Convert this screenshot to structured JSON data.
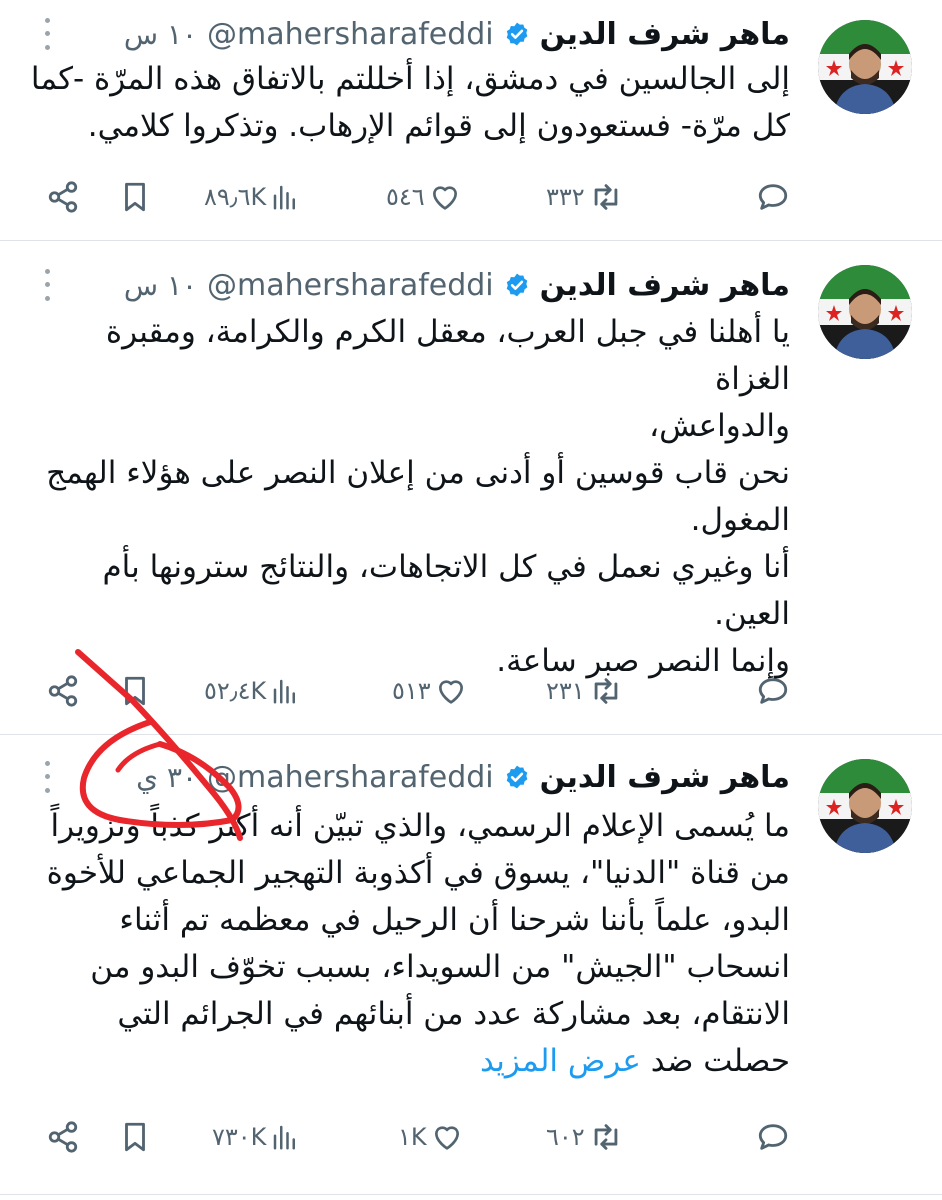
{
  "tweets": [
    {
      "display_name": "ماهر شرف الدين",
      "handle": "@mahersharafeddi",
      "time": "١٠ س",
      "text": "إلى الجالسين في دمشق، إذا أخللتم بالاتفاق هذه المرّة -كما\nكل مرّة- فستعودون إلى قوائم الإرهاب. وتذكروا كلامي.",
      "show_more": "",
      "replies": "",
      "retweets": "٣٣٢",
      "likes": "٥٤٦",
      "views": "٨٩٫٦K"
    },
    {
      "display_name": "ماهر شرف الدين",
      "handle": "@mahersharafeddi",
      "time": "١٠ س",
      "text": "يا أهلنا في جبل العرب، معقل الكرم والكرامة، ومقبرة الغزاة\nوالدواعش،\nنحن قاب قوسين أو أدنى من إعلان النصر على هؤلاء الهمج\nالمغول.\nأنا وغيري نعمل في كل الاتجاهات، والنتائج سترونها بأم\nالعين.\nوإنما النصر صبر ساعة.",
      "show_more": "",
      "replies": "",
      "retweets": "٢٣١",
      "likes": "٥١٣",
      "views": "٥٢٫٤K"
    },
    {
      "display_name": "ماهر شرف الدين",
      "handle": "@mahersharafeddi",
      "time": "٣٠ ي",
      "text": "ما يُسمى الإعلام الرسمي، والذي تبيّن أنه أكثر كذباً وتزويراً\nمن قناة \"الدنيا\"، يسوق في أكذوبة التهجير الجماعي للأخوة\nالبدو، علماً بأننا شرحنا أن الرحيل في معظمه تم أثناء\nانسحاب \"الجيش\" من السويداء، بسبب تخوّف البدو من\nالانتقام، بعد مشاركة عدد من أبنائهم في الجرائم التي\nحصلت ضد ",
      "show_more": "عرض المزيد",
      "replies": "",
      "retweets": "٦٠٢",
      "likes": "١K",
      "views": "٧٣٠K"
    }
  ],
  "colors": {
    "text": "#0f1419",
    "secondary": "#536471",
    "link": "#1d9bf0",
    "verified": "#1d9bf0",
    "annotation": "#e8262b"
  },
  "icons": [
    "share-icon",
    "bookmark-icon",
    "views-icon",
    "like-icon",
    "retweet-icon",
    "reply-icon",
    "verified-icon",
    "more-icon"
  ]
}
